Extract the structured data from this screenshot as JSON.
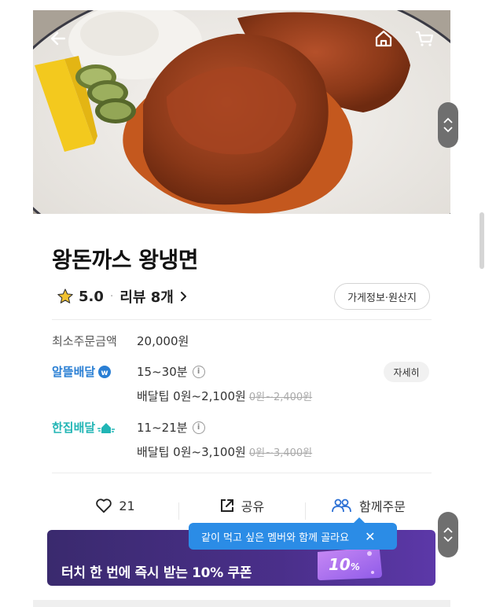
{
  "header": {
    "back_icon": "arrow-left-icon",
    "home_icon": "home-icon",
    "cart_icon": "cart-icon"
  },
  "store": {
    "name": "왕돈까스 왕냉면",
    "rating": "5.0",
    "reviews_label": "리뷰 8개",
    "info_button": "가게정보·원산지"
  },
  "min_order": {
    "label": "최소주문금액",
    "value": "20,000원"
  },
  "delivery": [
    {
      "name": "알뜰배달",
      "time": "15~30분",
      "tip": "배달팁 0원~2,100원",
      "tip_original": "0원~2,400원",
      "color": "#2a7fd4"
    },
    {
      "name": "한집배달",
      "time": "11~21분",
      "tip": "배달팁 0원~3,100원",
      "tip_original": "0원~3,400원",
      "color": "#21b5b5"
    }
  ],
  "detail_button": "자세히",
  "actions": {
    "like_count": "21",
    "share": "공유",
    "group_order": "함께주문"
  },
  "tooltip": {
    "text": "같이 먹고 싶은 멤버와 함께 골라요",
    "close": "✕"
  },
  "coupon": {
    "text": "터치 한 번에 즉시 받는 10% 쿠폰",
    "badge": "10",
    "badge_unit": "%"
  },
  "colors": {
    "accent_blue": "#2b8ce6",
    "coupon_bg": "#3a2a6e",
    "star": "#f2c230"
  }
}
